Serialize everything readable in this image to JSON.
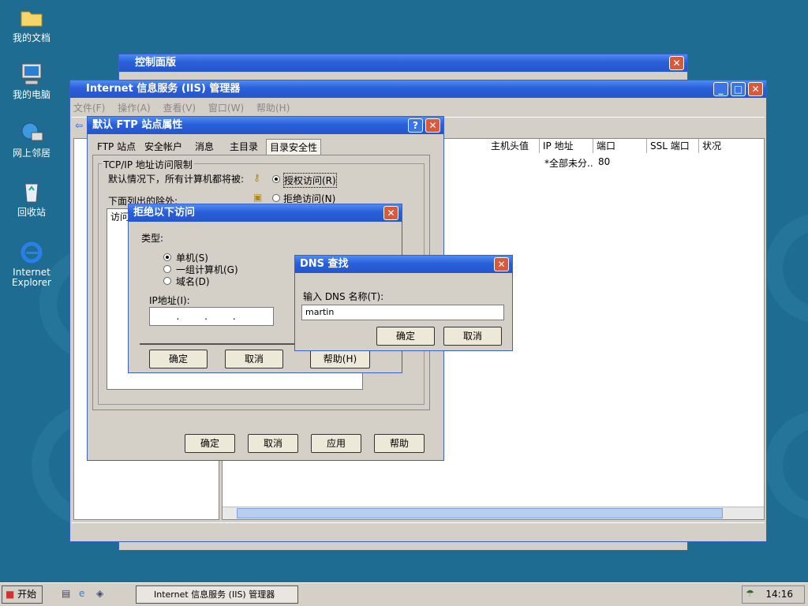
{
  "desktop": {
    "icons": [
      {
        "label": "我的文档",
        "icon": "folder-icon"
      },
      {
        "label": "我的电脑",
        "icon": "computer-icon"
      },
      {
        "label": "网上邻居",
        "icon": "network-icon"
      },
      {
        "label": "回收站",
        "icon": "recycle-bin-icon"
      },
      {
        "label": "Internet Explorer",
        "icon": "ie-icon"
      }
    ]
  },
  "control_panel": {
    "title": "控制面版"
  },
  "iis": {
    "title": "Internet 信息服务 (IIS) 管理器",
    "menu": [
      "文件(F)",
      "操作(A)",
      "查看(V)",
      "窗口(W)",
      "帮助(H)"
    ],
    "columns": [
      "主机头值",
      "IP 地址",
      "端口",
      "SSL 端口",
      "状况"
    ],
    "row": {
      "ip": "*全部未分..",
      "port": "80"
    }
  },
  "ftp": {
    "title": "默认 FTP 站点属性",
    "help": "?",
    "tabs": [
      "FTP 站点",
      "安全帐户",
      "消息",
      "主目录",
      "目录安全性"
    ],
    "group": "TCP/IP 地址访问限制",
    "default_text": "默认情况下，所有计算机都将被:",
    "grant": "授权访问(R)",
    "deny": "拒绝访问(N)",
    "except_text": "下面列出的除外:",
    "list_header": "访问",
    "buttons": {
      "ok": "确定",
      "cancel": "取消",
      "apply": "应用",
      "help": "帮助"
    }
  },
  "deny": {
    "title": "拒绝以下访问",
    "type_label": "类型:",
    "options": [
      "单机(S)",
      "一组计算机(G)",
      "域名(D)"
    ],
    "ip_label": "IP地址(I):",
    "ip_value": ". . .",
    "buttons": {
      "ok": "确定",
      "cancel": "取消",
      "help": "帮助(H)"
    }
  },
  "dns": {
    "title": "DNS 查找",
    "prompt": "输入 DNS 名称(T):",
    "value": "martin",
    "buttons": {
      "ok": "确定",
      "cancel": "取消"
    }
  },
  "taskbar": {
    "start": "开始",
    "task": "Internet 信息服务 (IIS) 管理器",
    "time": "14:16"
  }
}
